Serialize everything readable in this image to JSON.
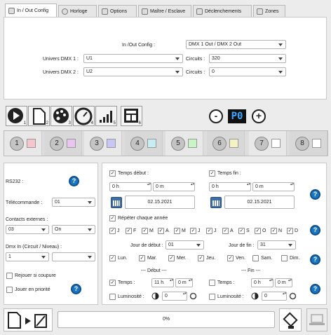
{
  "tabs": [
    {
      "label": "In / Out Config",
      "icon": "in-out-config-icon"
    },
    {
      "label": "Horloge",
      "icon": "clock-icon"
    },
    {
      "label": "Options",
      "icon": "options-icon"
    },
    {
      "label": "Maître / Esclave",
      "icon": "master-slave-icon"
    },
    {
      "label": "Déclenchements",
      "icon": "trigger-icon"
    },
    {
      "label": "Zones",
      "icon": "zones-icon"
    }
  ],
  "config": {
    "in_out_label": "In /Out Config :",
    "in_out_value": "DMX 1 Out / DMX 2 Out",
    "u1_label": "Univers DMX 1 :",
    "u1_value": "U1",
    "u2_label": "Univers DMX 2 :",
    "u2_value": "U2",
    "c1_label": "Circuits :",
    "c1_value": "320",
    "c2_label": "Circuits :",
    "c2_value": "0"
  },
  "toolbar": {
    "buttons": [
      {
        "name": "play-icon",
        "num": "1"
      },
      {
        "name": "document-icon",
        "num": "2"
      },
      {
        "name": "palette-icon",
        "num": "3"
      },
      {
        "name": "gauge-icon",
        "num": "4"
      },
      {
        "name": "signal-bars-icon",
        "num": "5"
      },
      {
        "name": "layout-grid-icon",
        "num": "6"
      }
    ],
    "minus": "-",
    "program": "P0",
    "plus": "+"
  },
  "channels": [
    {
      "num": "1",
      "color": "#f6c6cf"
    },
    {
      "num": "2",
      "color": "#e9c6f2"
    },
    {
      "num": "3",
      "color": "#c9c6f4"
    },
    {
      "num": "4",
      "color": "#c6eef4"
    },
    {
      "num": "5",
      "color": "#c9f4c6"
    },
    {
      "num": "6",
      "color": "#f4f2c2"
    },
    {
      "num": "7",
      "color": "#ffffff"
    },
    {
      "num": "8",
      "color": "#ffffff"
    }
  ],
  "left": {
    "rs232": "RS232 :",
    "telecommande_label": "Télécommande :",
    "telecommande_value": "01",
    "contacts_label": "Contacts externes :",
    "contacts_value": "03",
    "contacts_state": "On",
    "dmx_in_label": "Dmx In (Circuit / Niveau) :",
    "dmx_in_value": "1",
    "dmx_in_level": "",
    "rejouer": "Rejouer si coupure",
    "priorite": "Jouer en priorité"
  },
  "schedule": {
    "temps_debut": "Temps début :",
    "temps_fin": "Temps fin :",
    "debut_h": "0 h",
    "debut_m": "0 m",
    "fin_h": "0 h",
    "fin_m": "0 m",
    "date_debut": "02.15.2021",
    "date_fin": "02.15.2021",
    "repeter": "Répéter chaque année",
    "months": [
      "J",
      "F",
      "M",
      "A",
      "M",
      "J",
      "J",
      "A",
      "S",
      "O",
      "N",
      "D"
    ],
    "jour_debut_label": "Jour de début :",
    "jour_debut_value": "01",
    "jour_fin_label": "Jour de fin :",
    "jour_fin_value": "31",
    "days": [
      "Lun.",
      "Mar.",
      "Mer.",
      "Jeu.",
      "Ven.",
      "Sam.",
      "Dim."
    ],
    "debut_header": "--- Début ---",
    "fin_header": "--- Fin ---",
    "temps": "Temps :",
    "luminosite": "Luminosité :",
    "t1_h": "11 h",
    "t1_m": "0 m",
    "t2_h": "0 h",
    "t2_m": "0 m",
    "lum1": "0",
    "lum2": "0"
  },
  "bottom": {
    "progress_text": "0%",
    "progress": 0
  }
}
